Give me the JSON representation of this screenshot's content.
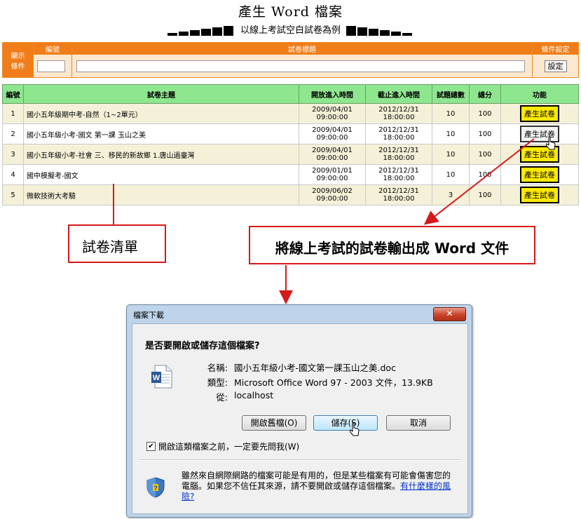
{
  "header": {
    "title": "產生 Word 檔案",
    "subtitle": "以線上考試空白試卷為例"
  },
  "filter": {
    "display_label_1": "顯示",
    "display_label_2": "條件",
    "col_number": "編號",
    "col_title": "試卷標題",
    "col_settings": "條件設定",
    "number_value": "",
    "title_value": "",
    "set_button": "設定"
  },
  "exam_table": {
    "headers": [
      "編號",
      "試卷主題",
      "開放進入時間",
      "截止進入時間",
      "試題總數",
      "總分",
      "功能"
    ],
    "rows": [
      {
        "no": "1",
        "topic": "國小五年級期中考-自然（1~2單元）",
        "open": "2009/04/01 09:00:00",
        "close": "2012/12/31 18:00:00",
        "count": "10",
        "score": "100",
        "action": "產生試卷"
      },
      {
        "no": "2",
        "topic": "國小五年級小考-國文 第一課 玉山之美",
        "open": "2009/04/01 09:00:00",
        "close": "2012/12/31 18:00:00",
        "count": "10",
        "score": "100",
        "action": "產生試卷"
      },
      {
        "no": "3",
        "topic": "國小五年級小考-社會 三、移民的新故鄉 1.唐山過臺灣",
        "open": "2009/04/01 09:00:00",
        "close": "2012/12/31 18:00:00",
        "count": "10",
        "score": "100",
        "action": "產生試卷"
      },
      {
        "no": "4",
        "topic": "國中模擬考-國文",
        "open": "2009/01/01 09:00:00",
        "close": "2012/12/31 18:00:00",
        "count": "10",
        "score": "100",
        "action": "產生試卷"
      },
      {
        "no": "5",
        "topic": "微軟技術大考驗",
        "open": "2009/06/02 09:00:00",
        "close": "2012/12/31 18:00:00",
        "count": "3",
        "score": "100",
        "action": "產生試卷"
      }
    ]
  },
  "annotations": {
    "list_callout": "試卷清單",
    "word_callout": "將線上考試的試卷輸出成 Word 文件",
    "color": "#d41a1a"
  },
  "dialog": {
    "title": "檔案下載",
    "question": "是否要開啟或儲存這個檔案?",
    "name_label": "名稱:",
    "name_value": "國小五年級小考-國文第一課玉山之美.doc",
    "type_label": "類型:",
    "type_value": "Microsoft Office Word 97 - 2003 文件，13.9KB",
    "from_label": "從:",
    "from_value": "localhost",
    "open_button": "開啟舊檔(O)",
    "save_button": "儲存(S)",
    "cancel_button": "取消",
    "checkbox_label": "開啟這類檔案之前，一定要先問我(W)",
    "checkbox_checked": true,
    "warning_text": "雖然來自網際網路的檔案可能是有用的，但是某些檔案有可能會傷害您的電腦。如果您不信任其來源，請不要開啟或儲存這個檔案。",
    "risk_link": "有什麼樣的風險?"
  },
  "icons": [
    "word-document-icon",
    "shield-icon",
    "close-icon",
    "mouse-cursor-icon",
    "checkmark-icon"
  ]
}
